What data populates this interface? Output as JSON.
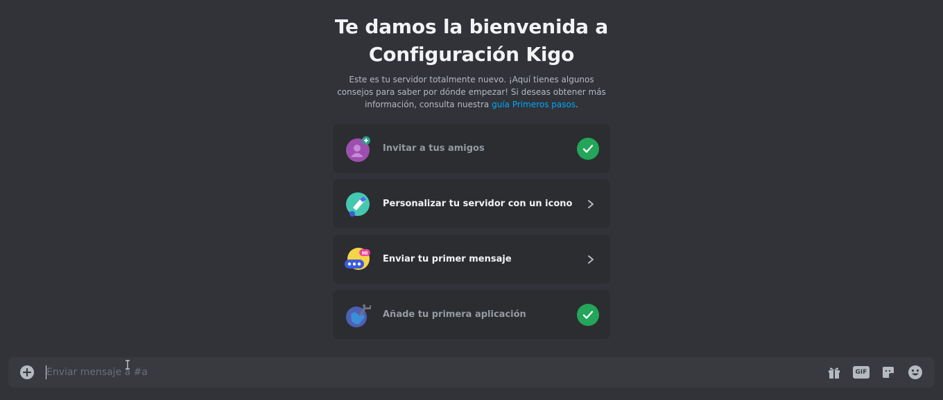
{
  "welcome": {
    "title": "Te damos la bienvenida a Configuración Kigo",
    "description_prefix": "Este es tu servidor totalmente nuevo. ¡Aquí tienes algunos consejos para saber por dónde empezar! Si deseas obtener más información, consulta nuestra ",
    "description_link": "guía Primeros pasos",
    "description_suffix": "."
  },
  "cards": [
    {
      "label": "Invitar a tus amigos",
      "status": "done",
      "icon": "invite-friends-icon"
    },
    {
      "label": "Personalizar tu servidor con un icono",
      "status": "todo",
      "icon": "customize-brush-icon"
    },
    {
      "label": "Enviar tu primer mensaje",
      "status": "todo",
      "icon": "send-message-icon"
    },
    {
      "label": "Añade tu primera aplicación",
      "status": "done",
      "icon": "add-app-icon"
    }
  ],
  "composer": {
    "placeholder": "Enviar mensaje a #a",
    "gif_label": "GIF"
  },
  "colors": {
    "background": "#313338",
    "card": "#2b2d31",
    "link": "#00a8fc",
    "success": "#23a55a"
  }
}
